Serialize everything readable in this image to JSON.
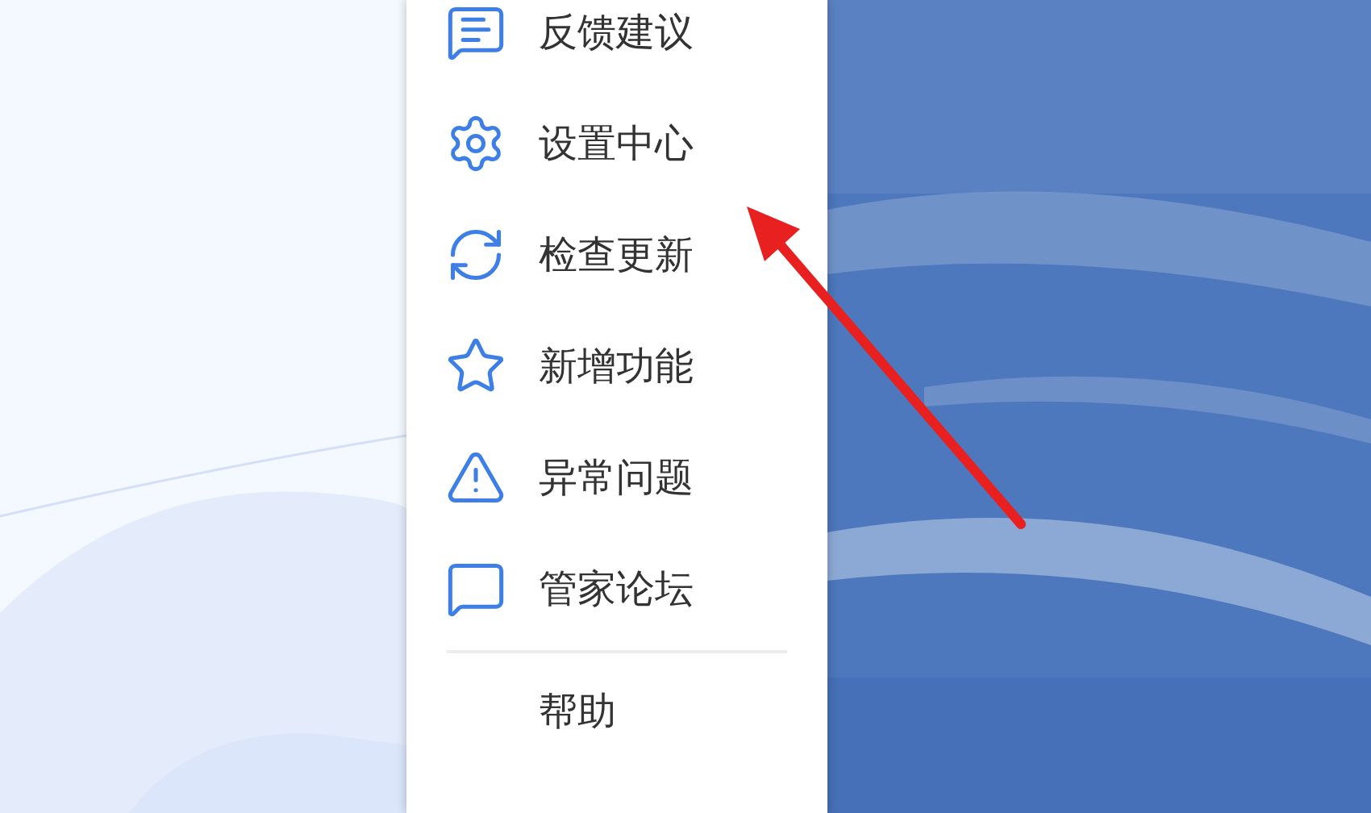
{
  "menu": {
    "items": [
      {
        "kind": "feedback",
        "label": "反馈建议"
      },
      {
        "kind": "settings",
        "label": "设置中心"
      },
      {
        "kind": "update",
        "label": "检查更新"
      },
      {
        "kind": "new",
        "label": "新增功能"
      },
      {
        "kind": "problem",
        "label": "异常问题"
      },
      {
        "kind": "forum",
        "label": "管家论坛"
      }
    ],
    "footer_items": [
      {
        "label": "帮助"
      }
    ]
  }
}
